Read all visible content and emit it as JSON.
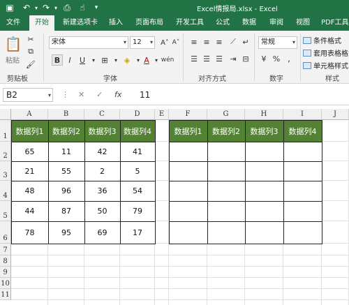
{
  "window": {
    "title": "Excel情报局.xlsx  -  Excel"
  },
  "quick_access": [
    "save-icon",
    "undo-icon",
    "redo-icon",
    "print-preview-icon",
    "touch-mode-icon",
    "customize-icon"
  ],
  "tabs": [
    "文件",
    "开始",
    "新建选项卡",
    "插入",
    "页面布局",
    "开发工具",
    "公式",
    "数据",
    "审阅",
    "视图",
    "PDF工具"
  ],
  "active_tab": "开始",
  "ribbon": {
    "clipboard": {
      "paste": "粘贴",
      "label": "剪贴板"
    },
    "font": {
      "name": "宋体",
      "size": "12",
      "label": "字体"
    },
    "alignment": {
      "label": "对齐方式"
    },
    "number": {
      "format": "常规",
      "label": "数字"
    },
    "styles": {
      "cond_format": "条件格式",
      "table_format": "套用表格格式",
      "cell_style": "单元格样式",
      "label": "样式"
    }
  },
  "formula_bar": {
    "name_box": "B2",
    "value": "11"
  },
  "columns": [
    "A",
    "B",
    "C",
    "D",
    "E",
    "F",
    "G",
    "H",
    "I",
    "J"
  ],
  "rows": [
    "1",
    "2",
    "3",
    "4",
    "5",
    "6",
    "7",
    "8",
    "9",
    "10",
    "11"
  ],
  "table_left": {
    "headers": [
      "数据列1",
      "数据列2",
      "数据列3",
      "数据列4"
    ],
    "rows": [
      [
        "65",
        "11",
        "42",
        "41"
      ],
      [
        "21",
        "55",
        "2",
        "5"
      ],
      [
        "48",
        "96",
        "36",
        "54"
      ],
      [
        "44",
        "87",
        "50",
        "79"
      ],
      [
        "78",
        "95",
        "69",
        "17"
      ]
    ]
  },
  "table_right": {
    "headers": [
      "数据列1",
      "数据列2",
      "数据列3",
      "数据列4"
    ]
  },
  "colors": {
    "excel_green": "#217346",
    "header_fill": "#548235"
  }
}
